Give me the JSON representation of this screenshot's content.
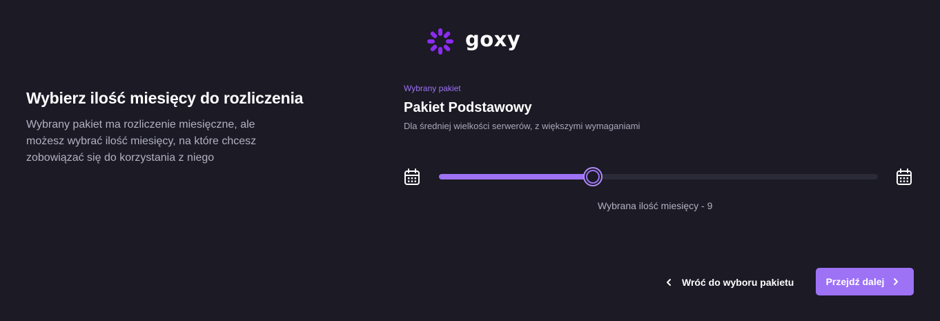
{
  "brand": {
    "name": "goxy",
    "accent_color": "#9d72f5",
    "logo_icon": "goxy-logo-icon"
  },
  "intro": {
    "heading": "Wybierz ilość miesięcy do rozliczenia",
    "description": "Wybrany pakiet ma rozliczenie miesięczne, ale możesz wybrać ilość miesięcy, na które chcesz zobowiązać się do korzystania z niego"
  },
  "package": {
    "eyebrow": "Wybrany pakiet",
    "name": "Pakiet Podstawowy",
    "description": "Dla średniej wielkości serwerów, z większymi wymaganiami"
  },
  "months_slider": {
    "min_icon": "calendar-icon",
    "max_icon": "calendar-icon",
    "value": 9,
    "fill_fraction": 0.35,
    "selected_label": "Wybrana ilość miesięcy - 9"
  },
  "actions": {
    "back_label": "Wróć do wyboru pakietu",
    "back_icon": "chevron-left-icon",
    "next_label": "Przejdź dalej",
    "next_icon": "chevron-right-icon"
  }
}
